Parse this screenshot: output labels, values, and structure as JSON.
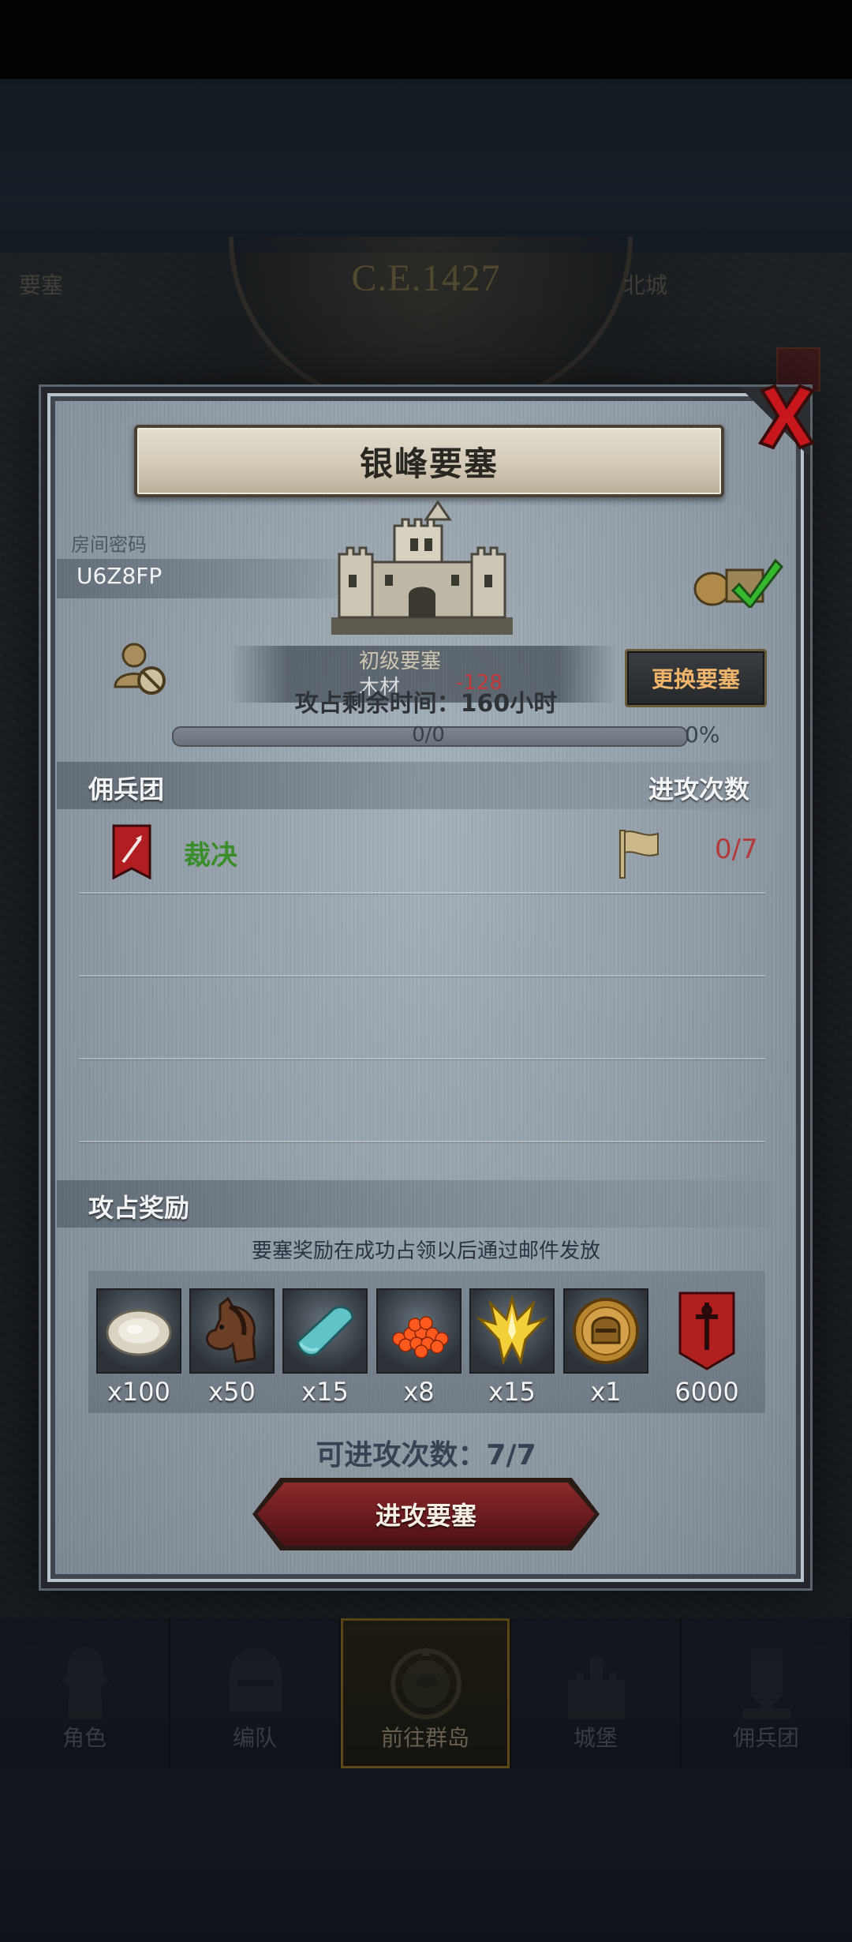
{
  "map": {
    "year": "C.E.1427",
    "left_label": "要塞",
    "right_label": "北城"
  },
  "dialog": {
    "title": "银峰要塞",
    "room_code_label": "房间密码",
    "room_code": "U6Z8FP",
    "info_line_1": "初级要塞",
    "info_line_2_label": "木材",
    "info_line_2_value": "-128",
    "switch_button": "更换要塞",
    "time_remaining": "攻占剩余时间：160小时",
    "progress": {
      "text": "0/0",
      "percent_text": "0%",
      "fraction": 0
    },
    "mercenary_section": {
      "title": "佣兵团",
      "attack_count_header": "进攻次数",
      "rows": [
        {
          "name": "裁决",
          "attempts": "0/7"
        }
      ]
    },
    "rewards_section": {
      "title": "攻占奖励",
      "note": "要塞奖励在成功占领以后通过邮件发放",
      "items": [
        {
          "icon": "oyster-icon",
          "qty": "x100"
        },
        {
          "icon": "horse-icon",
          "qty": "x50"
        },
        {
          "icon": "cloth-icon",
          "qty": "x15"
        },
        {
          "icon": "caviar-icon",
          "qty": "x8"
        },
        {
          "icon": "golden-crown-icon",
          "qty": "x15"
        },
        {
          "icon": "helmet-medal-icon",
          "qty": "x1"
        },
        {
          "icon": "red-banner-icon",
          "qty": "6000"
        }
      ]
    },
    "attack_times": "可进攻次数：7/7",
    "attack_button": "进攻要塞"
  },
  "bottom_nav": [
    {
      "label": "角色",
      "icon": "knight-icon"
    },
    {
      "label": "编队",
      "icon": "helmet-icon"
    },
    {
      "label": "前往群岛",
      "icon": "compass-icon"
    },
    {
      "label": "城堡",
      "icon": "castle-icon"
    },
    {
      "label": "佣兵团",
      "icon": "mercenary-icon"
    }
  ],
  "colors": {
    "accent_gold": "#f0b46a",
    "merc_name_green": "#3a8e2a",
    "attempts_red": "#b33a3a",
    "button_red": "#6a1b1e"
  }
}
